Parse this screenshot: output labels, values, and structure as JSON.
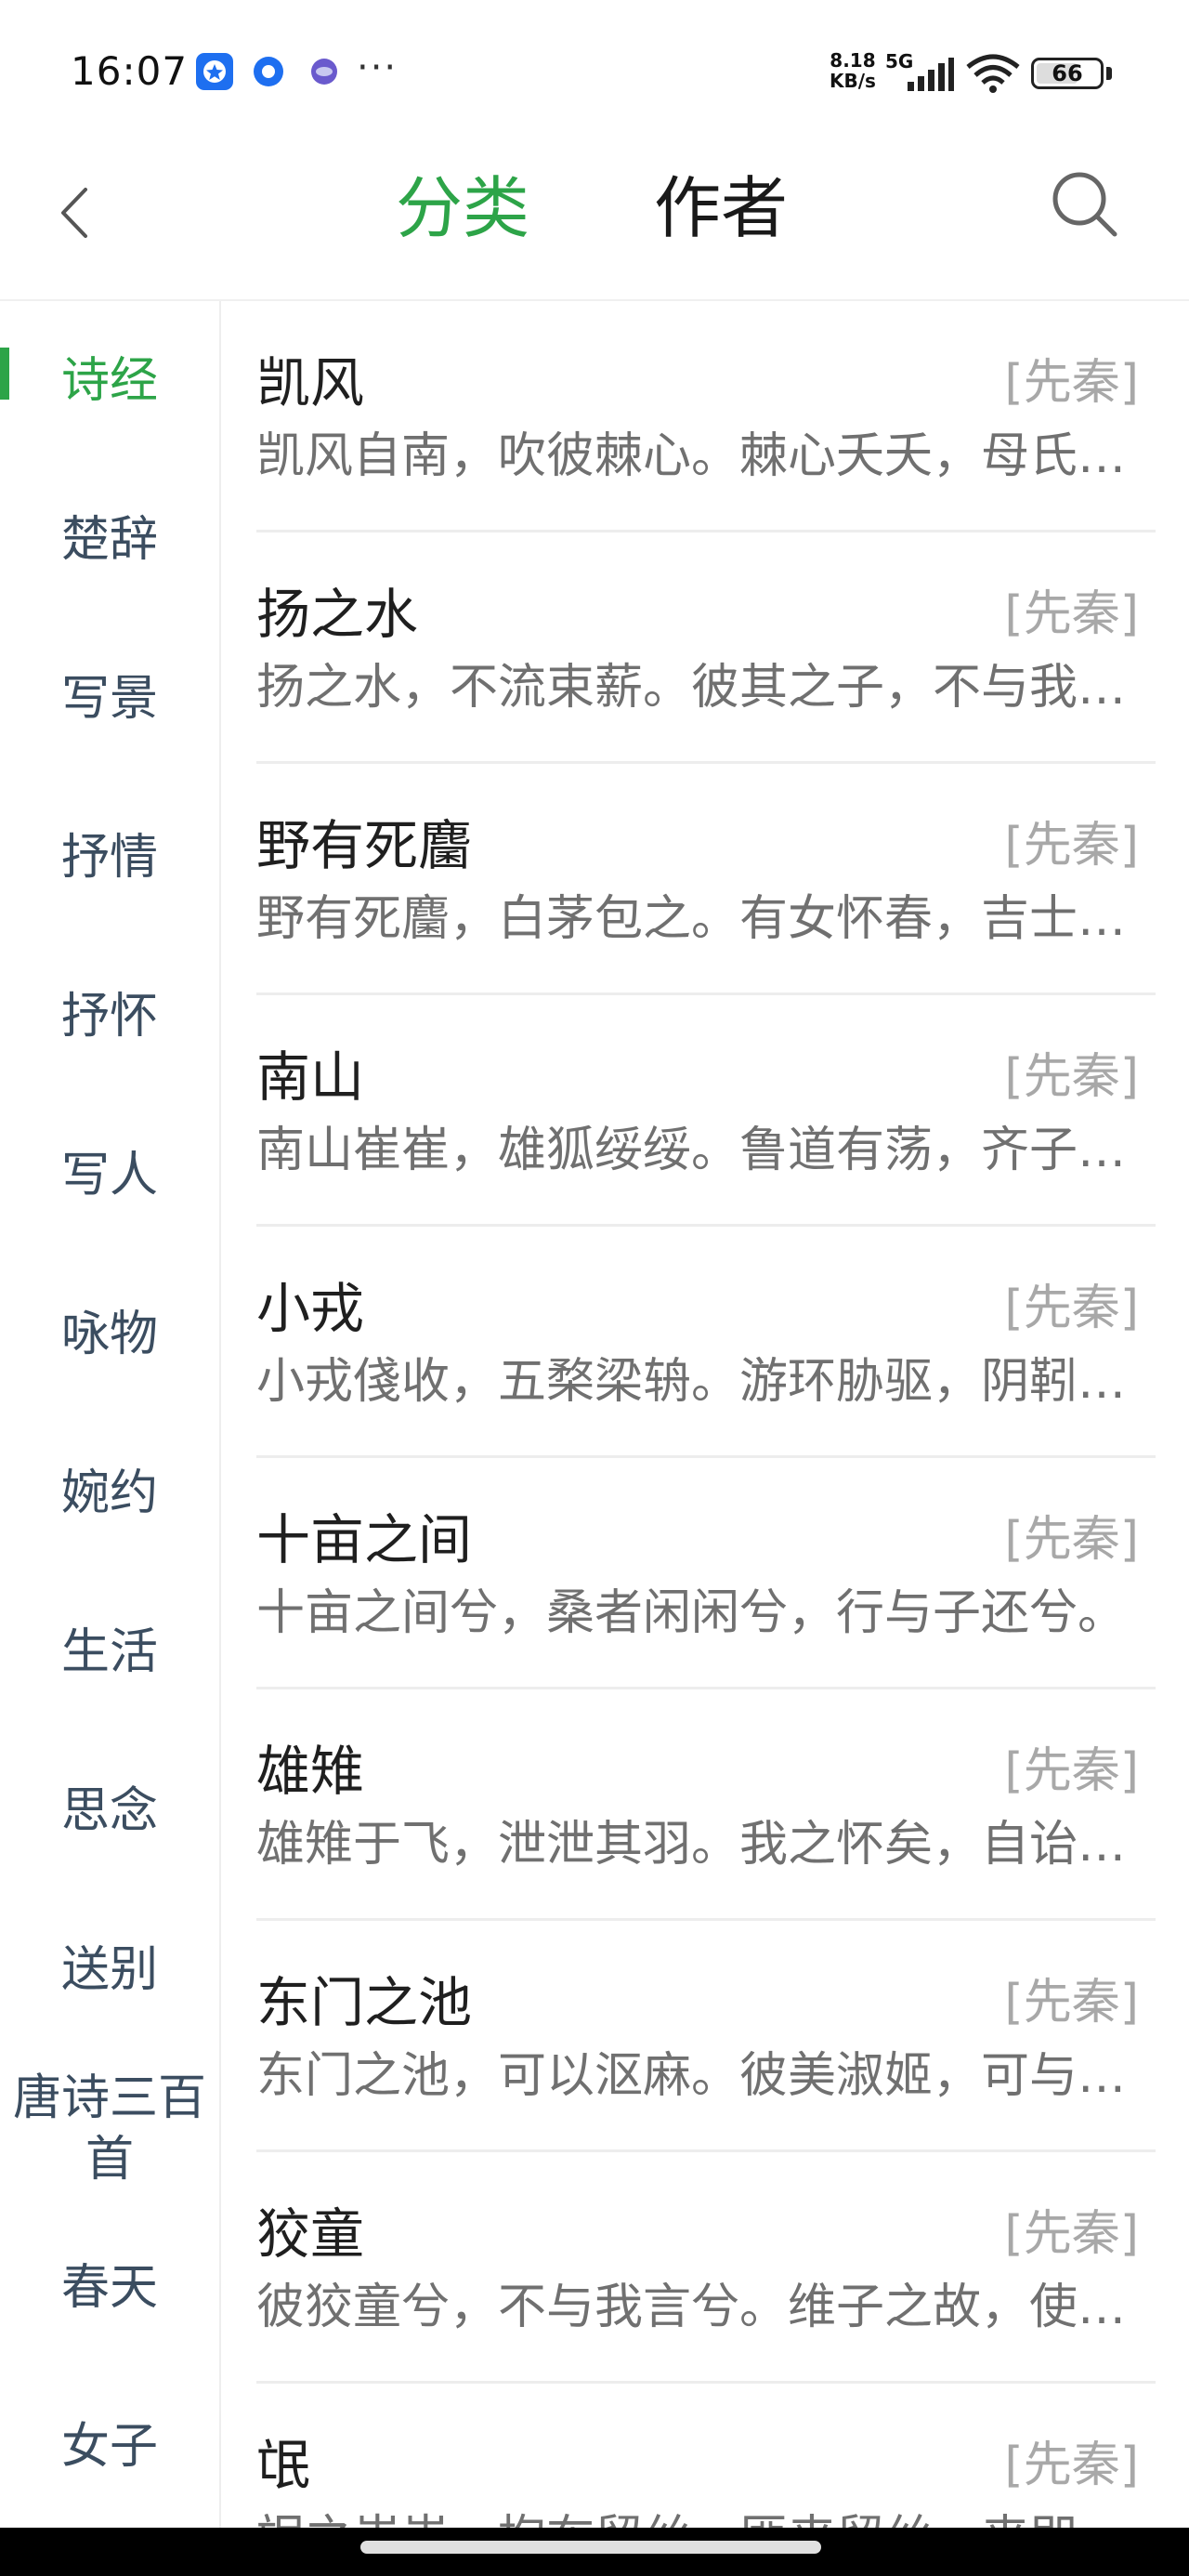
{
  "status_bar": {
    "time": "16:07",
    "overflow_dots": "···",
    "net_speed_value": "8.18",
    "net_speed_unit": "KB/s",
    "network_type": "5G",
    "battery_level": 66,
    "battery_text": "66"
  },
  "top_nav": {
    "tabs": [
      "分类",
      "作者"
    ],
    "active_tab": "分类",
    "accent_color": "#2da448"
  },
  "sidebar": {
    "items": [
      "诗经",
      "楚辞",
      "写景",
      "抒情",
      "抒怀",
      "写人",
      "咏物",
      "婉约",
      "生活",
      "思念",
      "送别",
      "唐诗三百首",
      "春天",
      "女子"
    ],
    "active_index": 0
  },
  "poems": [
    {
      "title": "凯风",
      "dynasty": "[先秦]",
      "excerpt": "凯风自南，吹彼棘心。棘心夭夭，母氏劬劳。"
    },
    {
      "title": "扬之水",
      "dynasty": "[先秦]",
      "excerpt": "扬之水，不流束薪。彼其之子，不与我戍申。"
    },
    {
      "title": "野有死麕",
      "dynasty": "[先秦]",
      "excerpt": "野有死麕，白茅包之。有女怀春，吉士诱之。"
    },
    {
      "title": "南山",
      "dynasty": "[先秦]",
      "excerpt": "南山崔崔，雄狐绥绥。鲁道有荡，齐子由归。"
    },
    {
      "title": "小戎",
      "dynasty": "[先秦]",
      "excerpt": "小戎俴收，五楘梁辀。游环胁驱，阴靷鋈续。"
    },
    {
      "title": "十亩之间",
      "dynasty": "[先秦]",
      "excerpt": "十亩之间兮，桑者闲闲兮，行与子还兮。"
    },
    {
      "title": "雄雉",
      "dynasty": "[先秦]",
      "excerpt": "雄雉于飞，泄泄其羽。我之怀矣，自诒伊阻。"
    },
    {
      "title": "东门之池",
      "dynasty": "[先秦]",
      "excerpt": "东门之池，可以沤麻。彼美淑姬，可与晤歌。"
    },
    {
      "title": "狡童",
      "dynasty": "[先秦]",
      "excerpt": "彼狡童兮，不与我言兮。维子之故，使我不能餐兮。"
    },
    {
      "title": "氓",
      "dynasty": "[先秦]",
      "excerpt": "氓之蚩蚩，抱布贸丝。匪来贸丝，来即我谋。"
    }
  ]
}
